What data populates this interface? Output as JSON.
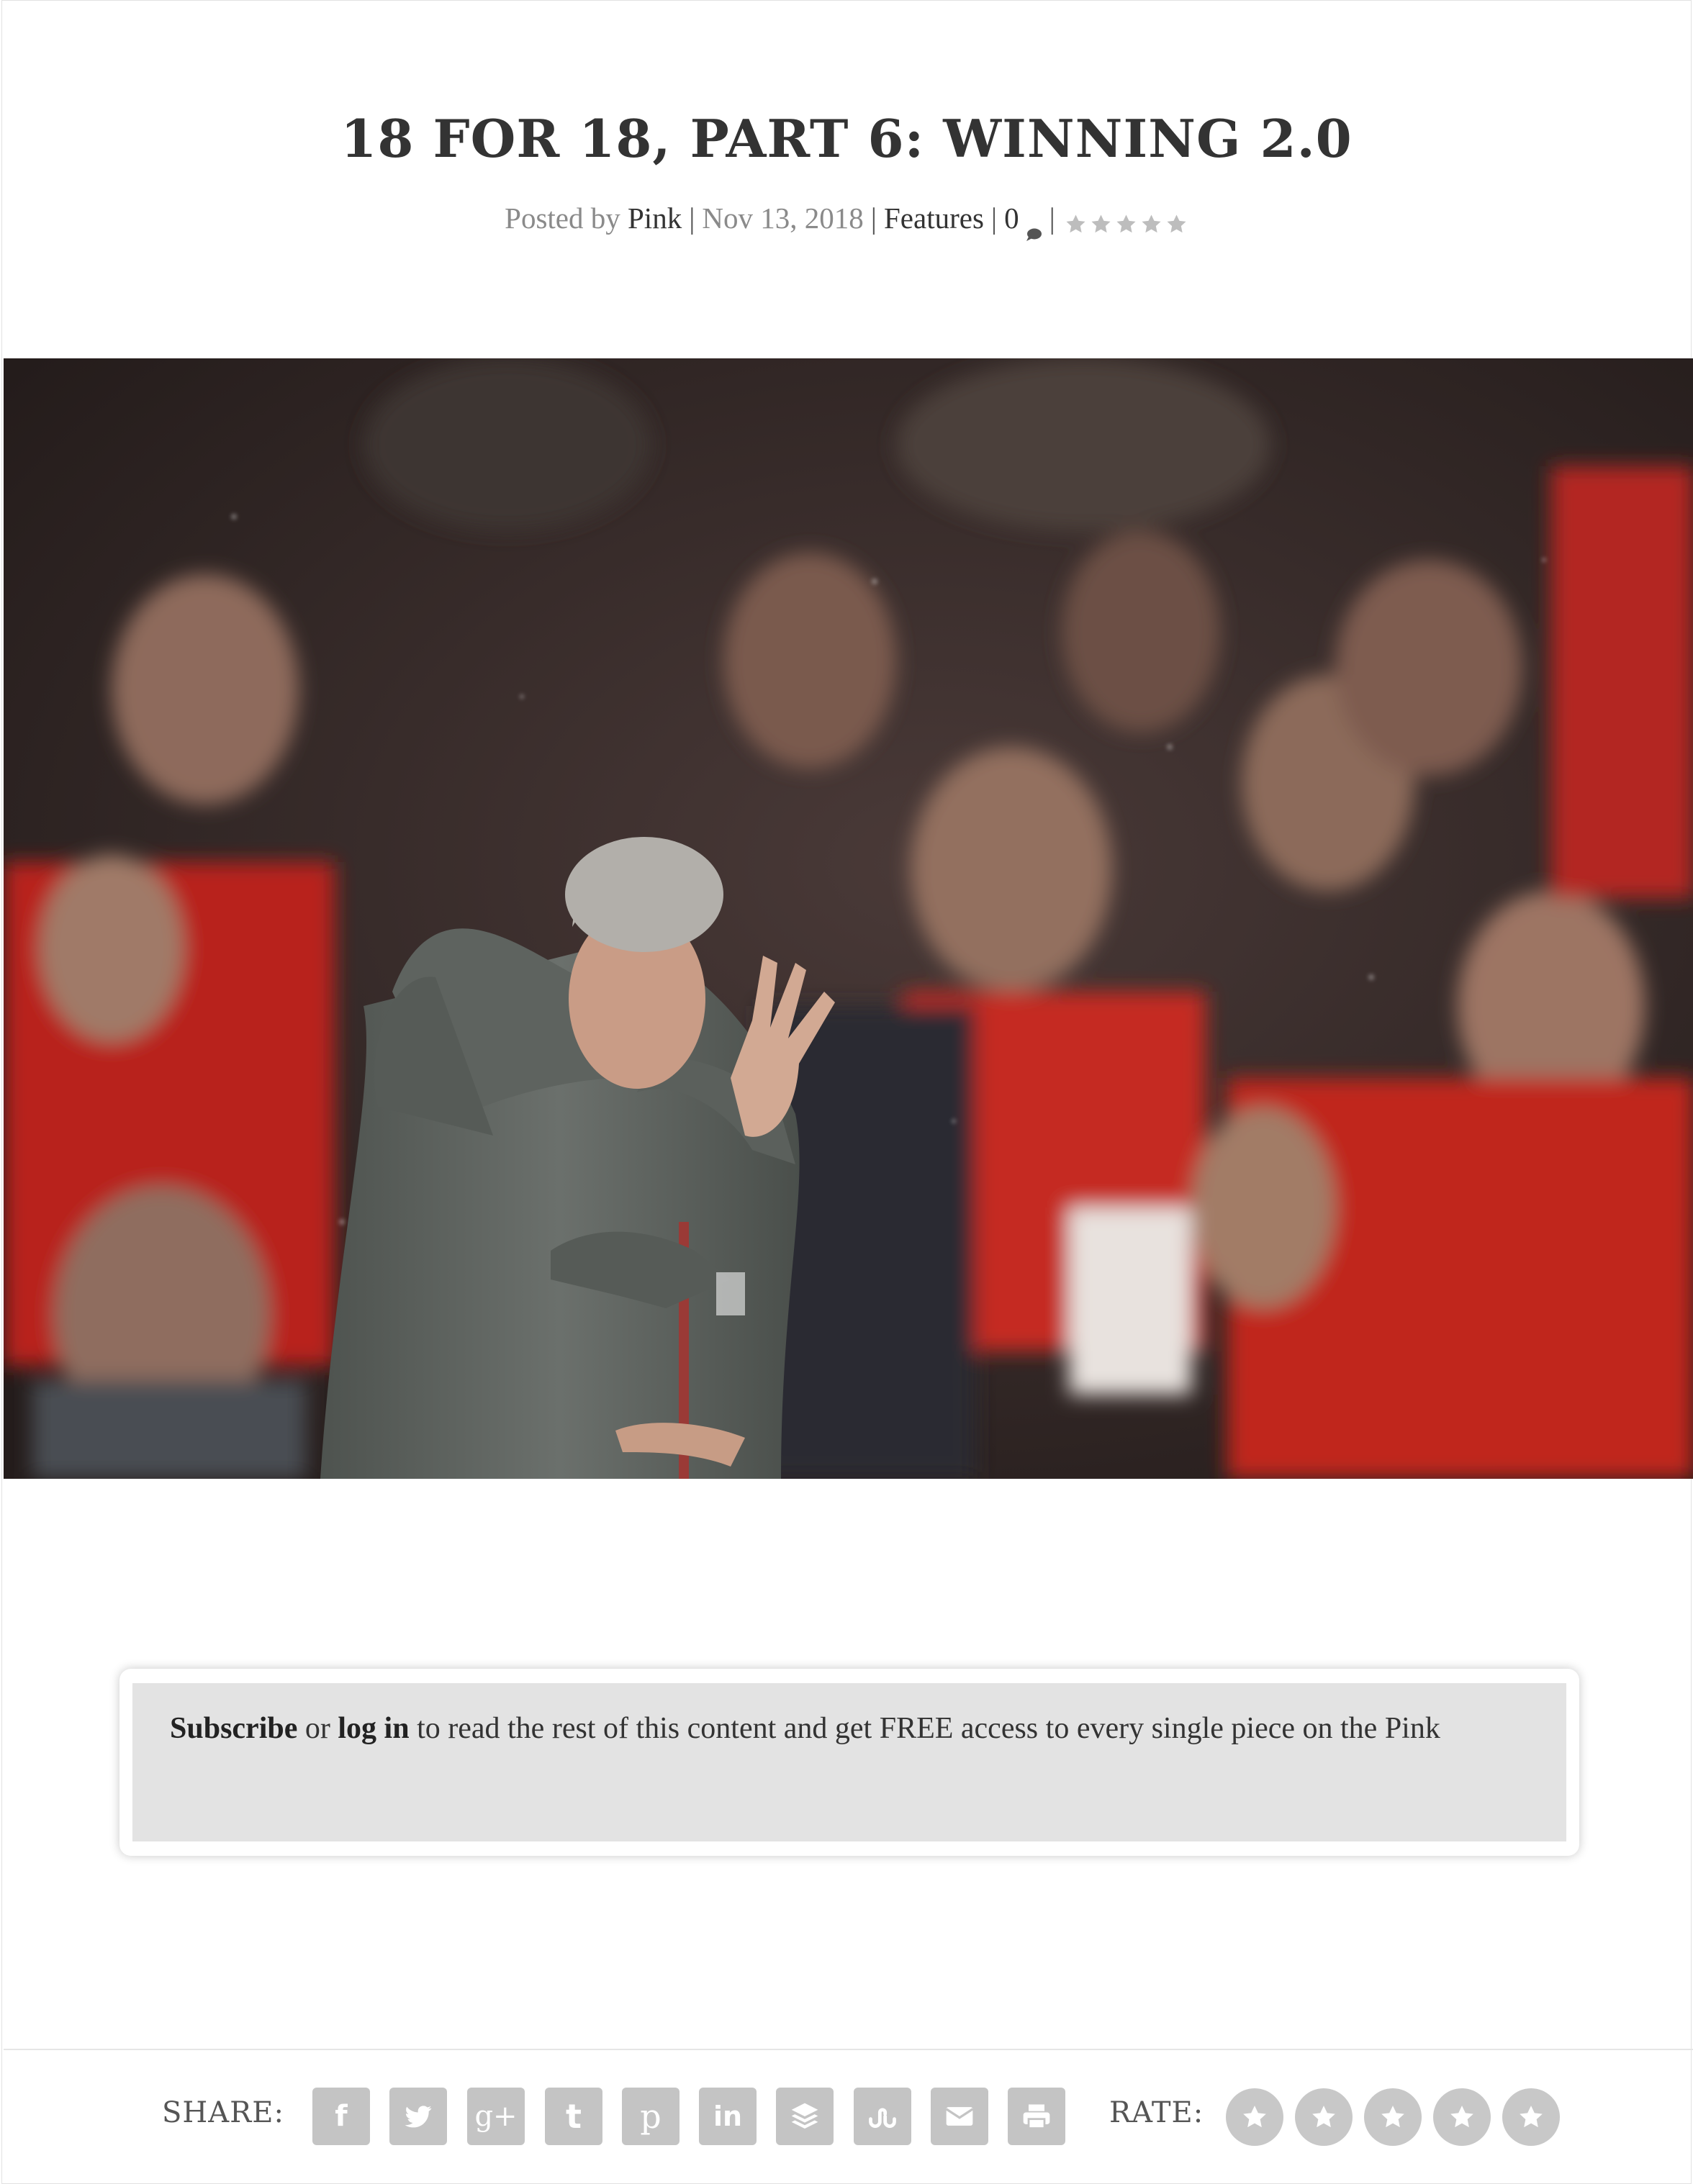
{
  "post": {
    "title": "18 FOR 18, PART 6: WINNING 2.0",
    "meta": {
      "posted_by_prefix": "Posted by",
      "author": "Pink",
      "date": "Nov 13, 2018",
      "category": "Features",
      "comment_count": "0",
      "rating_stars": 5,
      "separator": "|"
    }
  },
  "featured_image": {
    "alt_icon": "photo-image"
  },
  "gate": {
    "subscribe_label": "Subscribe",
    "or_text": "or",
    "login_label": "log in",
    "message": "to read the rest of this content and get FREE access to every single piece on the Pink"
  },
  "footer": {
    "share_label": "SHARE:",
    "rate_label": "RATE:",
    "share_icons": [
      "facebook-icon",
      "twitter-icon",
      "google-plus-icon",
      "tumblr-icon",
      "pinterest-icon",
      "linkedin-icon",
      "buffer-icon",
      "stumbleupon-icon",
      "email-icon",
      "print-icon"
    ],
    "share_glyphs": {
      "facebook": "f",
      "google_plus": "g+",
      "tumblr": "t",
      "pinterest": "p",
      "linkedin": "in"
    },
    "rate_star_count": 5
  },
  "colors": {
    "text": "#333333",
    "meta": "#8a8a8a",
    "button_gray": "#c4c4c4",
    "gate_bg": "#e3e3e3"
  }
}
